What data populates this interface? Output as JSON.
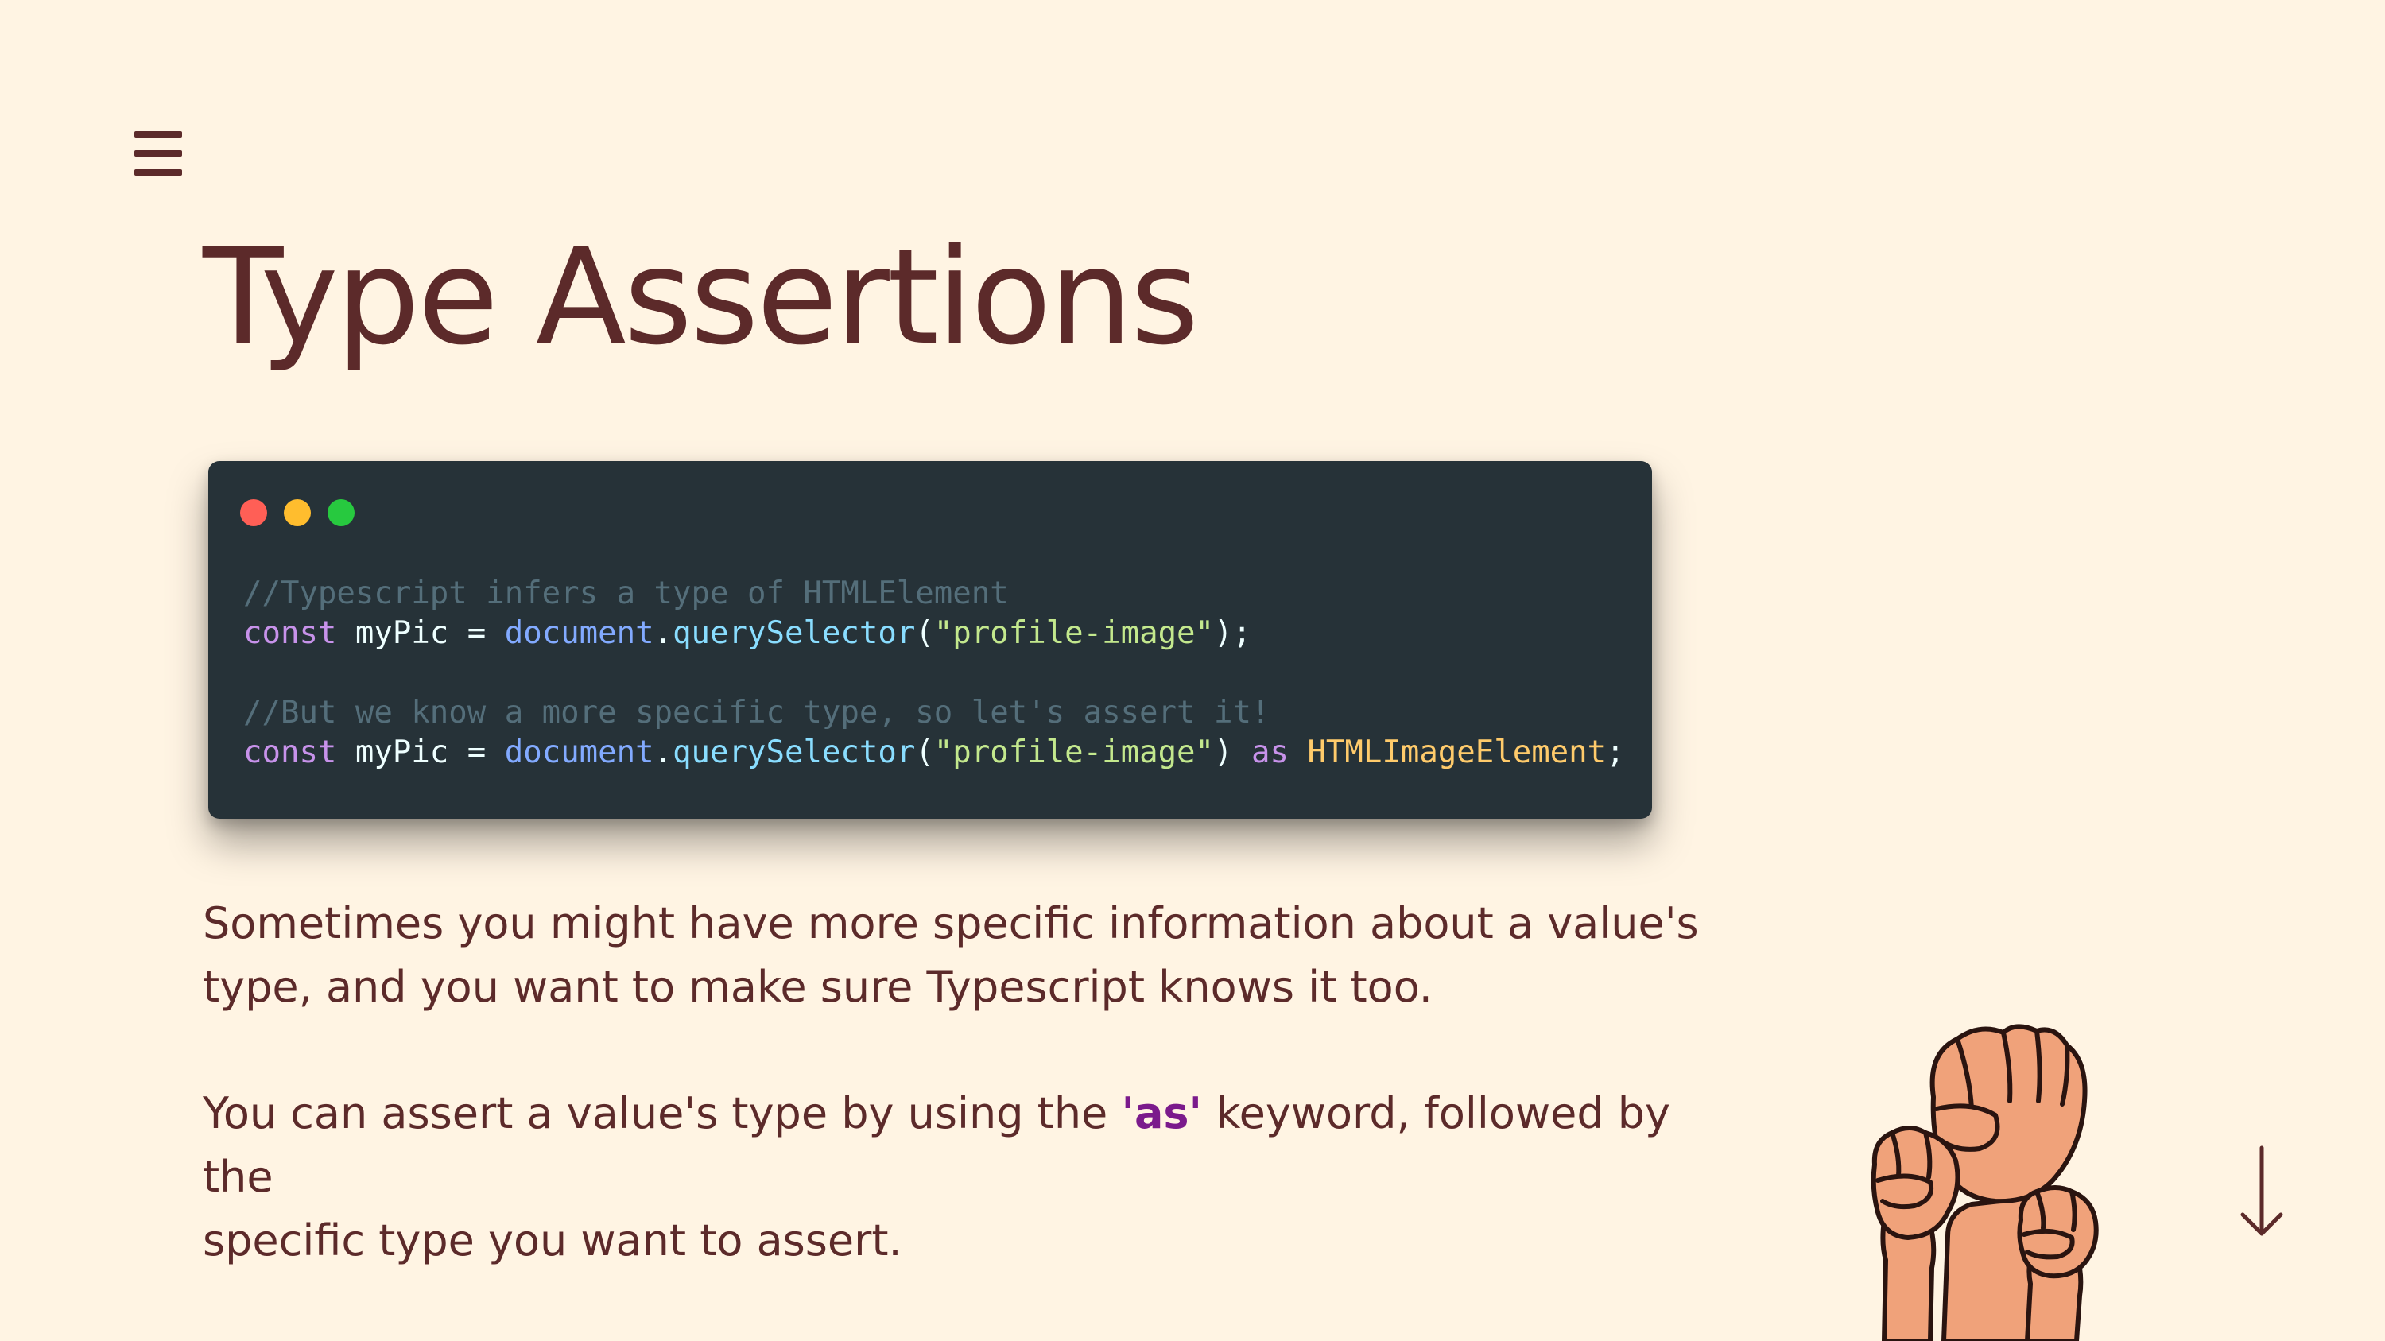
{
  "slide": {
    "title": "Type Assertions"
  },
  "code_window": {
    "lines": [
      [
        {
          "t": "//Typescript infers a type of HTMLElement",
          "c": "comment"
        }
      ],
      [
        {
          "t": "const",
          "c": "keyword"
        },
        {
          "t": " myPic ",
          "c": "ident"
        },
        {
          "t": "=",
          "c": "punct"
        },
        {
          "t": " ",
          "c": "punct"
        },
        {
          "t": "document",
          "c": "object"
        },
        {
          "t": ".",
          "c": "punct"
        },
        {
          "t": "querySelector",
          "c": "method"
        },
        {
          "t": "(",
          "c": "punct"
        },
        {
          "t": "\"profile-image\"",
          "c": "string"
        },
        {
          "t": ");",
          "c": "punct"
        }
      ],
      [],
      [
        {
          "t": "//But we know a more specific type, so let's assert it!",
          "c": "comment"
        }
      ],
      [
        {
          "t": "const",
          "c": "keyword"
        },
        {
          "t": " myPic ",
          "c": "ident"
        },
        {
          "t": "=",
          "c": "punct"
        },
        {
          "t": " ",
          "c": "punct"
        },
        {
          "t": "document",
          "c": "object"
        },
        {
          "t": ".",
          "c": "punct"
        },
        {
          "t": "querySelector",
          "c": "method"
        },
        {
          "t": "(",
          "c": "punct"
        },
        {
          "t": "\"profile-image\"",
          "c": "string"
        },
        {
          "t": ") ",
          "c": "punct"
        },
        {
          "t": "as",
          "c": "keyword"
        },
        {
          "t": " ",
          "c": "punct"
        },
        {
          "t": "HTMLImageElement",
          "c": "type"
        },
        {
          "t": ";",
          "c": "punct"
        }
      ]
    ],
    "dots": [
      {
        "name": "close-dot",
        "color": "#ff5f56"
      },
      {
        "name": "minimize-dot",
        "color": "#ffbd2e"
      },
      {
        "name": "maximize-dot",
        "color": "#27c93f"
      }
    ]
  },
  "paragraph_1": {
    "line_1": "Sometimes you might have more specific information about a value's",
    "line_2": "type, and you want to make sure Typescript knows it too."
  },
  "paragraph_2": {
    "before": "You can assert a value's type by using the ",
    "keyword": "'as'",
    "after_line_1": " keyword, followed by the",
    "line_2": "specific type you want to assert."
  },
  "icons": {
    "menu": "hamburger-menu-icon",
    "arrow": "arrow-down-icon",
    "illustration": "raised-fists-illustration"
  },
  "colors": {
    "background": "#fff4e3",
    "text": "#5c2a2a",
    "code_bg": "#263238",
    "keyword_highlight": "#7b1a8c",
    "skin": "#f0a27a"
  }
}
